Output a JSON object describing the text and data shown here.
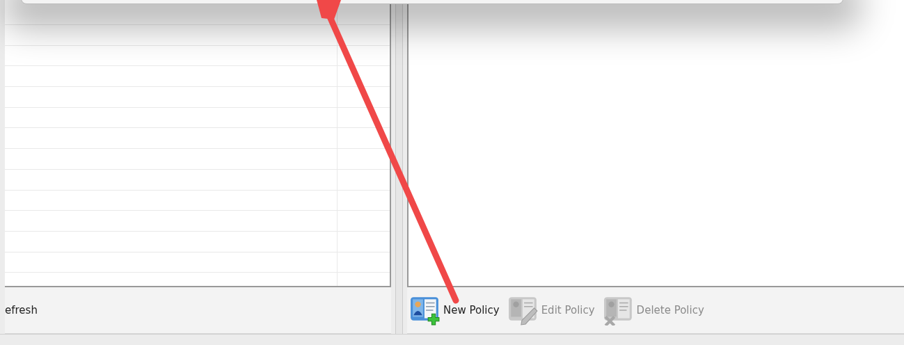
{
  "left_toolbar": {
    "buttons": [
      {
        "label": "efresh",
        "disabled": false
      }
    ]
  },
  "right_toolbar": {
    "buttons": [
      {
        "kind": "new",
        "label": "New Policy",
        "disabled": false
      },
      {
        "kind": "edit",
        "label": "Edit Policy",
        "disabled": true
      },
      {
        "kind": "delete",
        "label": "Delete Policy",
        "disabled": true
      }
    ]
  }
}
